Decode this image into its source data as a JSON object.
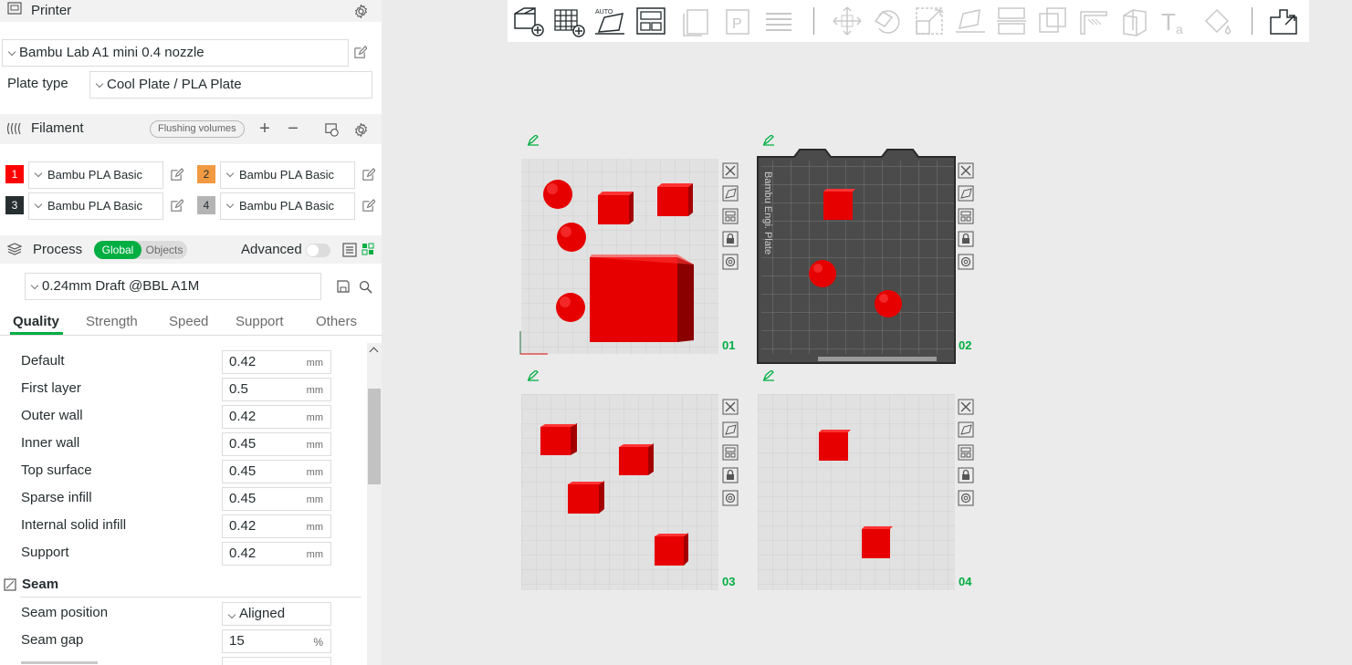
{
  "printer": {
    "title": "Printer",
    "preset": "Bambu Lab A1 mini 0.4 nozzle",
    "plate_type_label": "Plate type",
    "plate_type": "Cool Plate / PLA Plate"
  },
  "filament": {
    "title": "Filament",
    "flushing_label": "Flushing volumes",
    "items": [
      {
        "num": "1",
        "name": "Bambu PLA Basic",
        "color": "#ff0000"
      },
      {
        "num": "2",
        "name": "Bambu PLA Basic",
        "color": "#f29a42"
      },
      {
        "num": "3",
        "name": "Bambu PLA Basic",
        "color": "#262e30"
      },
      {
        "num": "4",
        "name": "Bambu PLA Basic",
        "color": "#b4b4b4"
      }
    ]
  },
  "process": {
    "title": "Process",
    "global_label": "Global",
    "objects_label": "Objects",
    "advanced_label": "Advanced",
    "preset": "0.24mm Draft @BBL A1M",
    "tabs": [
      "Quality",
      "Strength",
      "Speed",
      "Support",
      "Others"
    ],
    "line_width": [
      {
        "label": "Default",
        "value": "0.42",
        "unit": "mm"
      },
      {
        "label": "First layer",
        "value": "0.5",
        "unit": "mm"
      },
      {
        "label": "Outer wall",
        "value": "0.42",
        "unit": "mm"
      },
      {
        "label": "Inner wall",
        "value": "0.45",
        "unit": "mm"
      },
      {
        "label": "Top surface",
        "value": "0.45",
        "unit": "mm"
      },
      {
        "label": "Sparse infill",
        "value": "0.45",
        "unit": "mm"
      },
      {
        "label": "Internal solid infill",
        "value": "0.42",
        "unit": "mm"
      },
      {
        "label": "Support",
        "value": "0.42",
        "unit": "mm"
      }
    ],
    "seam": {
      "title": "Seam",
      "position_label": "Seam position",
      "position_value": "Aligned",
      "gap_label": "Seam gap",
      "gap_value": "15",
      "gap_unit": "%"
    }
  },
  "plates": [
    {
      "name": "01",
      "selected": false
    },
    {
      "name": "02",
      "selected": true,
      "bed_text": "Bambu Engi. Plate"
    },
    {
      "name": "03",
      "selected": false
    },
    {
      "name": "04",
      "selected": false
    }
  ],
  "colors": {
    "accent": "#00ae42",
    "object": "#e60000"
  }
}
